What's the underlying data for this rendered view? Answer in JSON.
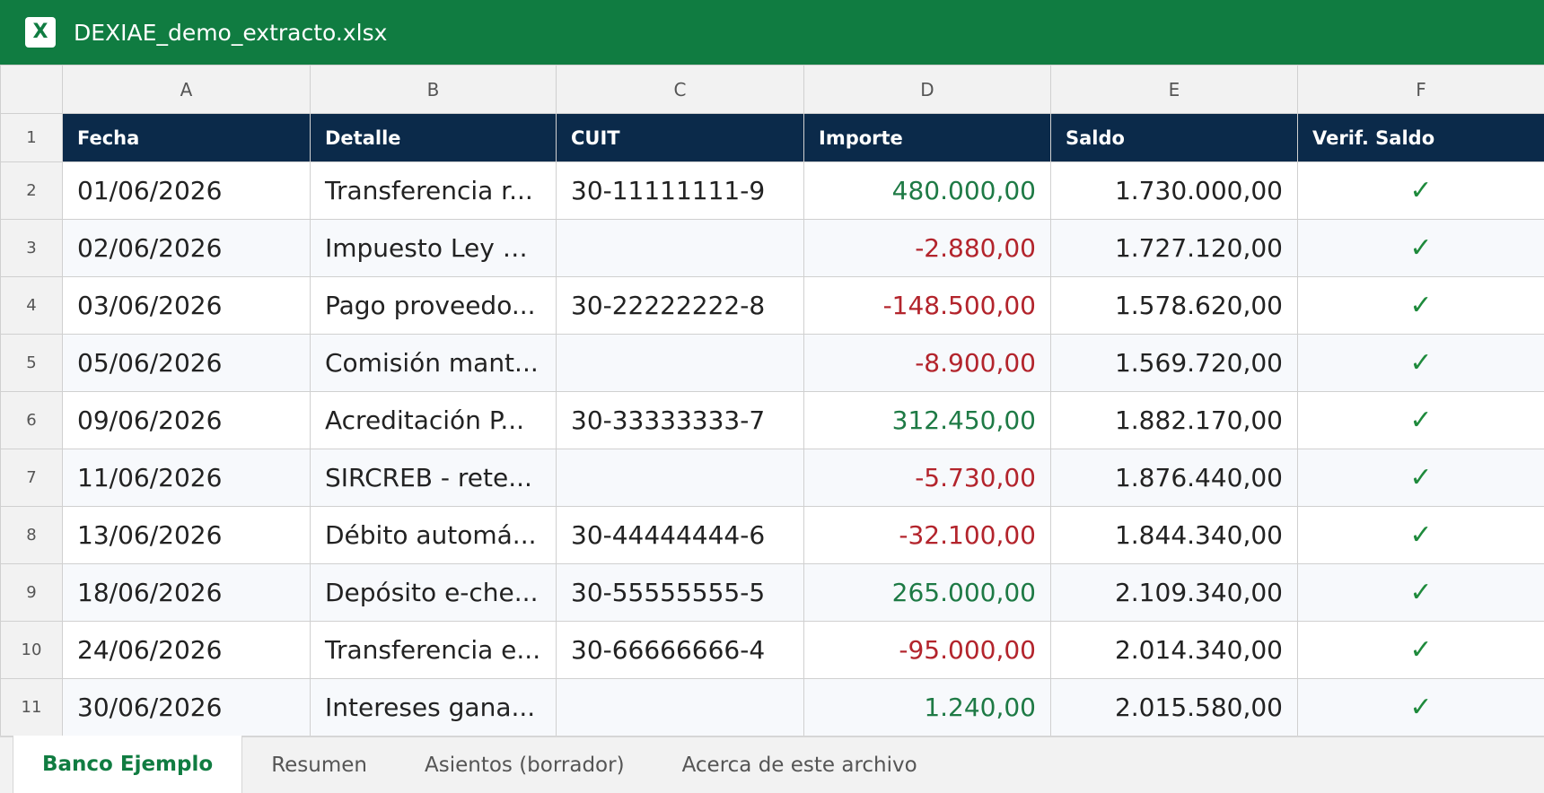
{
  "window": {
    "title": "DEXIAE_demo_extracto.xlsx",
    "icon": "excel-icon",
    "icon_letter": "X",
    "accent_color": "#107c41"
  },
  "columns": [
    "A",
    "B",
    "C",
    "D",
    "E",
    "F"
  ],
  "header_row": {
    "row_number": "1",
    "cells": [
      "Fecha",
      "Detalle",
      "CUIT",
      "Importe",
      "Saldo",
      "Verif. Saldo"
    ],
    "background": "#0b2a4a"
  },
  "rows": [
    {
      "n": "2",
      "fecha": "01/06/2026",
      "detalle": "Transferencia r...",
      "cuit": "30-11111111-9",
      "importe": "480.000,00",
      "saldo": "1.730.000,00",
      "verif": "✓"
    },
    {
      "n": "3",
      "fecha": "02/06/2026",
      "detalle": "Impuesto Ley 2...",
      "cuit": "",
      "importe": "-2.880,00",
      "saldo": "1.727.120,00",
      "verif": "✓"
    },
    {
      "n": "4",
      "fecha": "03/06/2026",
      "detalle": "Pago proveedo...",
      "cuit": "30-22222222-8",
      "importe": "-148.500,00",
      "saldo": "1.578.620,00",
      "verif": "✓"
    },
    {
      "n": "5",
      "fecha": "05/06/2026",
      "detalle": "Comisión mant...",
      "cuit": "",
      "importe": "-8.900,00",
      "saldo": "1.569.720,00",
      "verif": "✓"
    },
    {
      "n": "6",
      "fecha": "09/06/2026",
      "detalle": "Acreditación P...",
      "cuit": "30-33333333-7",
      "importe": "312.450,00",
      "saldo": "1.882.170,00",
      "verif": "✓"
    },
    {
      "n": "7",
      "fecha": "11/06/2026",
      "detalle": "SIRCREB - rete...",
      "cuit": "",
      "importe": "-5.730,00",
      "saldo": "1.876.440,00",
      "verif": "✓"
    },
    {
      "n": "8",
      "fecha": "13/06/2026",
      "detalle": "Débito automá...",
      "cuit": "30-44444444-6",
      "importe": "-32.100,00",
      "saldo": "1.844.340,00",
      "verif": "✓"
    },
    {
      "n": "9",
      "fecha": "18/06/2026",
      "detalle": "Depósito e-che...",
      "cuit": "30-55555555-5",
      "importe": "265.000,00",
      "saldo": "2.109.340,00",
      "verif": "✓"
    },
    {
      "n": "10",
      "fecha": "24/06/2026",
      "detalle": "Transferencia e...",
      "cuit": "30-66666666-4",
      "importe": "-95.000,00",
      "saldo": "2.014.340,00",
      "verif": "✓"
    },
    {
      "n": "11",
      "fecha": "30/06/2026",
      "detalle": "Intereses gana...",
      "cuit": "",
      "importe": "1.240,00",
      "saldo": "2.015.580,00",
      "verif": "✓"
    }
  ],
  "colors": {
    "positive": "#1e7a45",
    "negative": "#b3242c",
    "check": "#1e8a3c"
  },
  "sheet_tabs": [
    {
      "label": "Banco Ejemplo",
      "active": true
    },
    {
      "label": "Resumen",
      "active": false
    },
    {
      "label": "Asientos (borrador)",
      "active": false
    },
    {
      "label": "Acerca de este archivo",
      "active": false
    }
  ]
}
